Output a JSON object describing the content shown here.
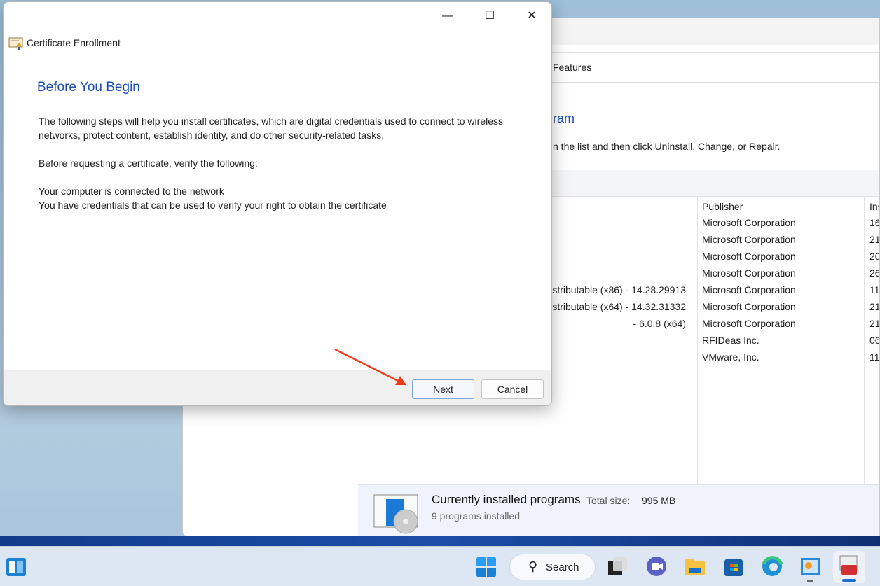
{
  "dialog": {
    "title": "Certificate Enrollment",
    "heading": "Before You Begin",
    "paragraph1": "The following steps will help you install certificates, which are digital credentials used to connect to wireless networks, protect content, establish identity, and do other security-related tasks.",
    "paragraph2": "Before requesting a certificate, verify the following:",
    "check1": "Your computer is connected to the network",
    "check2": "You have credentials that can be used to verify your right to obtain the certificate",
    "next_label": "Next",
    "cancel_label": "Cancel",
    "minimize": "—",
    "maximize": "☐",
    "close": "✕"
  },
  "background_window": {
    "breadcrumb_tail": "Features",
    "heading_fragment": "ram",
    "subtitle_fragment": "n the list and then click Uninstall, Change, or Repair.",
    "columns": {
      "publisher": "Publisher",
      "installed_on": "Ins"
    },
    "rows": [
      {
        "name": "",
        "publisher": "Microsoft Corporation",
        "installed": "16"
      },
      {
        "name": "",
        "publisher": "Microsoft Corporation",
        "installed": "21"
      },
      {
        "name": "",
        "publisher": "Microsoft Corporation",
        "installed": "20"
      },
      {
        "name": "",
        "publisher": "Microsoft Corporation",
        "installed": "26"
      },
      {
        "name": "stributable (x86) - 14.28.29913",
        "publisher": "Microsoft Corporation",
        "installed": "11"
      },
      {
        "name": "stributable (x64) - 14.32.31332",
        "publisher": "Microsoft Corporation",
        "installed": "21"
      },
      {
        "name": "- 6.0.8 (x64)",
        "publisher": "Microsoft Corporation",
        "installed": "21"
      },
      {
        "name": "",
        "publisher": "RFIDeas Inc.",
        "installed": "06"
      },
      {
        "name": "",
        "publisher": "VMware, Inc.",
        "installed": "11"
      }
    ],
    "details": {
      "title": "Currently installed programs",
      "size_label": "Total size:",
      "size_value": "995 MB",
      "count": "9 programs installed"
    }
  },
  "taskbar": {
    "search_label": "Search",
    "icons": [
      "widgets-icon",
      "start-icon",
      "search-icon",
      "task-view-icon",
      "teams-icon",
      "file-explorer-icon",
      "store-icon",
      "edge-icon",
      "control-panel-icon",
      "programs-features-icon"
    ]
  }
}
